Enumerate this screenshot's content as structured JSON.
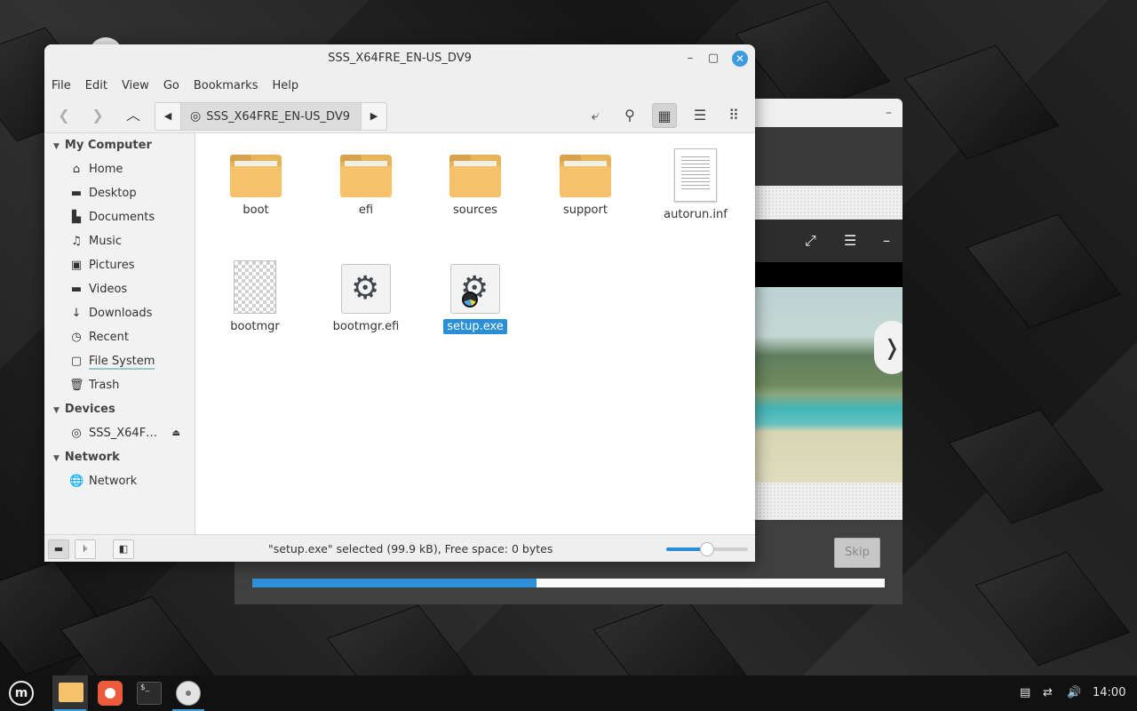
{
  "file_manager": {
    "title": "SSS_X64FRE_EN-US_DV9",
    "menu": [
      "File",
      "Edit",
      "View",
      "Go",
      "Bookmarks",
      "Help"
    ],
    "path_crumb": "SSS_X64FRE_EN-US_DV9",
    "sidebar": {
      "sections": [
        {
          "title": "My Computer",
          "items": [
            {
              "label": "Home",
              "icon": "home-icon"
            },
            {
              "label": "Desktop",
              "icon": "desktop-icon"
            },
            {
              "label": "Documents",
              "icon": "documents-icon"
            },
            {
              "label": "Music",
              "icon": "music-icon"
            },
            {
              "label": "Pictures",
              "icon": "pictures-icon"
            },
            {
              "label": "Videos",
              "icon": "videos-icon"
            },
            {
              "label": "Downloads",
              "icon": "downloads-icon"
            },
            {
              "label": "Recent",
              "icon": "recent-icon"
            },
            {
              "label": "File System",
              "icon": "filesystem-icon"
            },
            {
              "label": "Trash",
              "icon": "trash-icon"
            }
          ]
        },
        {
          "title": "Devices",
          "items": [
            {
              "label": "SSS_X64F…",
              "icon": "disc-icon"
            }
          ]
        },
        {
          "title": "Network",
          "items": [
            {
              "label": "Network",
              "icon": "network-icon"
            }
          ]
        }
      ]
    },
    "files": [
      {
        "name": "boot",
        "type": "folder"
      },
      {
        "name": "efi",
        "type": "folder"
      },
      {
        "name": "sources",
        "type": "folder"
      },
      {
        "name": "support",
        "type": "folder"
      },
      {
        "name": "autorun.inf",
        "type": "text"
      },
      {
        "name": "bootmgr",
        "type": "binary"
      },
      {
        "name": "bootmgr.efi",
        "type": "executable"
      },
      {
        "name": "setup.exe",
        "type": "executable",
        "selected": true
      }
    ],
    "status_text": "\"setup.exe\" selected (99.9 kB), Free space: 0 bytes",
    "zoom_level": 0.5,
    "accent": "#2a8fd6"
  },
  "installer": {
    "skip_label": "Skip",
    "progress": 0.45,
    "progress_color": "#2f91d9"
  },
  "taskbar": {
    "clock": "14:00"
  }
}
